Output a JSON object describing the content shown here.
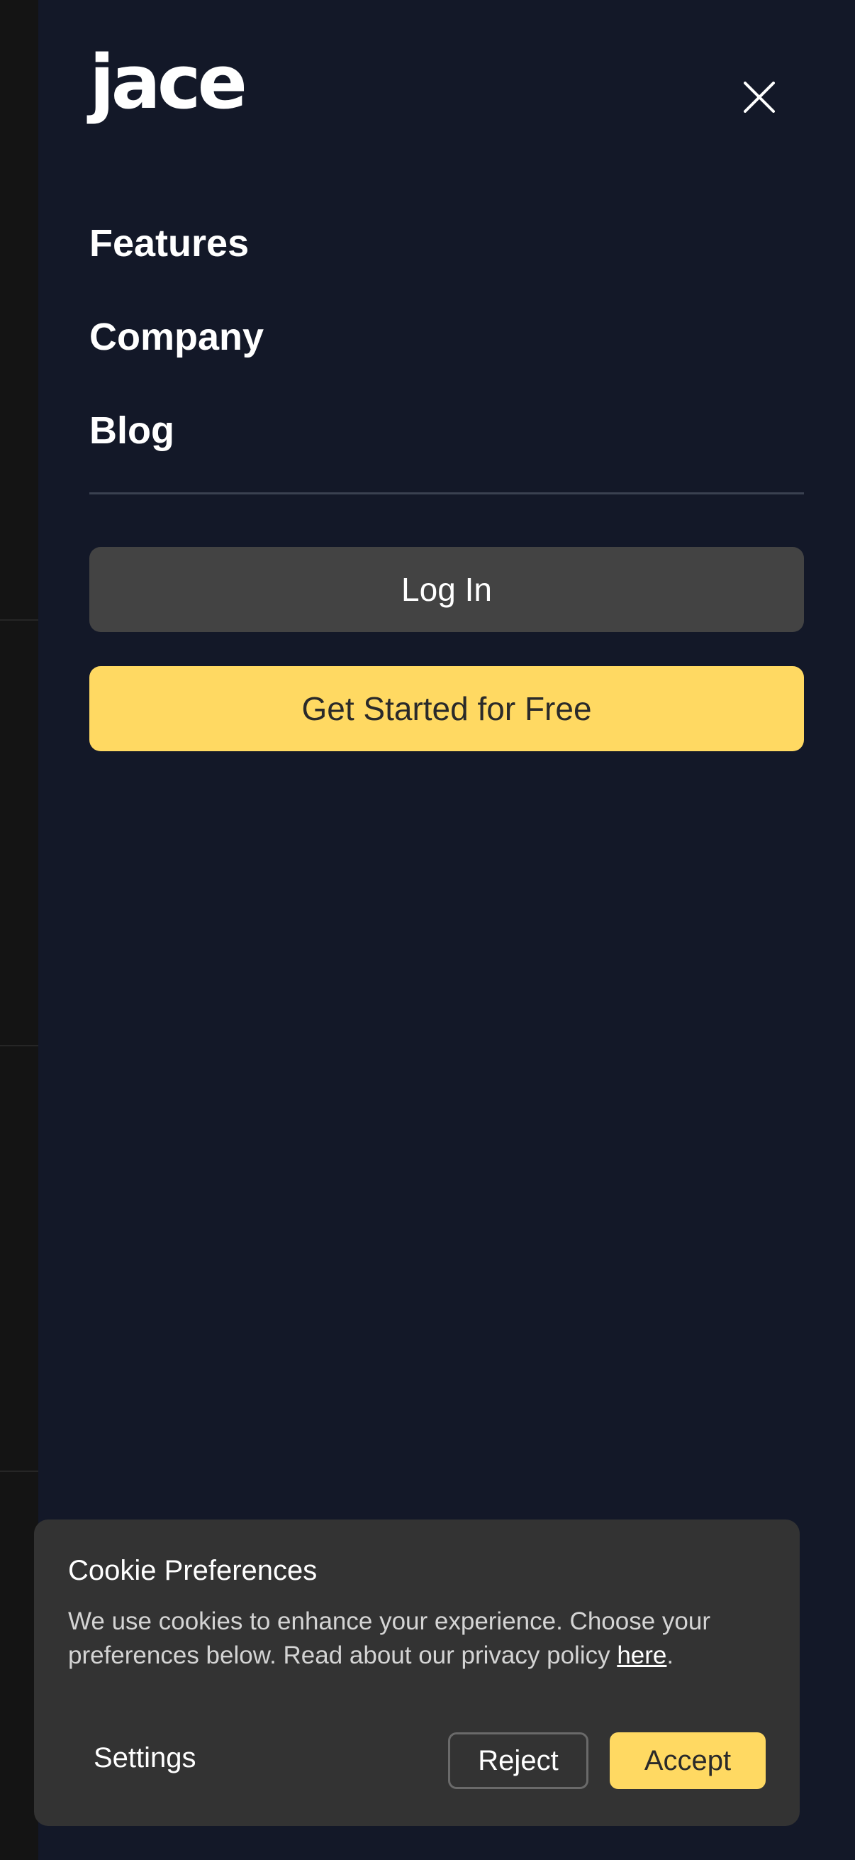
{
  "brand": {
    "logo_text": "jace"
  },
  "menu": {
    "close_icon": "close-icon",
    "items": [
      {
        "label": "Features"
      },
      {
        "label": "Company"
      },
      {
        "label": "Blog"
      }
    ],
    "login_label": "Log In",
    "cta_label": "Get Started for Free"
  },
  "cookie": {
    "title": "Cookie Preferences",
    "text_before": "We use cookies to enhance your experience. Choose your preferences below. Read about our privacy policy ",
    "link_text": "here",
    "text_after": ".",
    "settings_label": "Settings",
    "reject_label": "Reject",
    "accept_label": "Accept"
  },
  "colors": {
    "drawer_bg": "#131828",
    "accent": "#ffd962",
    "login_bg": "#434343",
    "cookie_bg": "#333333"
  }
}
